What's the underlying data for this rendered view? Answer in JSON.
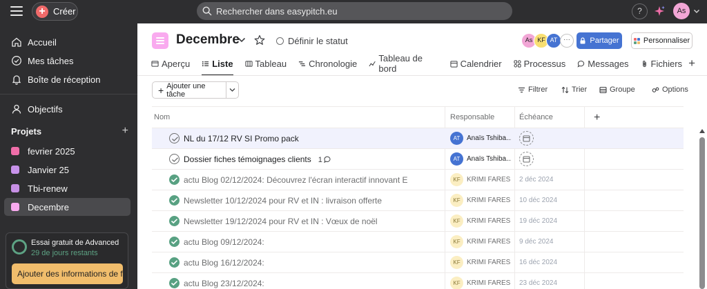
{
  "topbar": {
    "create_label": "Créer",
    "search_placeholder": "Rechercher dans easypitch.eu",
    "help_label": "?",
    "user_initials": "As"
  },
  "sidebar": {
    "nav": [
      {
        "label": "Accueil",
        "icon": "home-icon"
      },
      {
        "label": "Mes tâches",
        "icon": "check-circle-icon"
      },
      {
        "label": "Boîte de réception",
        "icon": "bell-icon"
      },
      {
        "label": "Objectifs",
        "icon": "person-icon"
      }
    ],
    "projects_title": "Projets",
    "projects_add": "+",
    "projects": [
      {
        "label": "fevrier 2025",
        "color": "#f06ea9"
      },
      {
        "label": "Janvier 25",
        "color": "#c792ea"
      },
      {
        "label": "Tbi-renew",
        "color": "#c68fe4"
      },
      {
        "label": "Decembre",
        "color": "#f9aaef",
        "active": true
      }
    ],
    "trial": {
      "title": "Essai gratuit de Advanced",
      "subtitle": "29 de jours restants",
      "button": "Ajouter des informations de facturation"
    }
  },
  "header": {
    "title": "Decembre",
    "status_label": "Définir le statut",
    "members": [
      {
        "initials": "As",
        "color": "#f2a6d6"
      },
      {
        "initials": "KF",
        "color": "#f8df72"
      },
      {
        "initials": "AT",
        "color": "#4573d2"
      }
    ],
    "members_more": "···",
    "share_label": "Partager",
    "customize_label": "Personnaliser"
  },
  "tabs": [
    {
      "label": "Aperçu",
      "icon": "overview-icon"
    },
    {
      "label": "Liste",
      "icon": "list-icon",
      "active": true
    },
    {
      "label": "Tableau",
      "icon": "board-icon"
    },
    {
      "label": "Chronologie",
      "icon": "timeline-icon"
    },
    {
      "label": "Tableau de bord",
      "icon": "dashboard-icon"
    },
    {
      "label": "Calendrier",
      "icon": "calendar-icon"
    },
    {
      "label": "Processus",
      "icon": "workflow-icon"
    },
    {
      "label": "Messages",
      "icon": "message-icon"
    },
    {
      "label": "Fichiers",
      "icon": "paperclip-icon"
    }
  ],
  "tabs_add": "+",
  "toolbar": {
    "add_task": "Ajouter une tâche",
    "filter": "Filtrer",
    "sort": "Trier",
    "group": "Groupe",
    "options": "Options"
  },
  "table": {
    "columns": [
      "Nom",
      "Responsable",
      "Échéance"
    ],
    "add_column": "+",
    "rows": [
      {
        "name": "NL du 17/12 RV SI Promo pack",
        "done": false,
        "assignee": "Anaïs Tshiba...",
        "initials": "AT",
        "av_color": "#4573d2",
        "due": "",
        "selected": true
      },
      {
        "name": "Dossier fiches témoignages clients",
        "done": false,
        "comments": "1",
        "assignee": "Anaïs Tshiba...",
        "initials": "AT",
        "av_color": "#4573d2",
        "due": ""
      },
      {
        "name": "actu Blog 02/12/2024: Découvrez l'écran interactif innovant E",
        "done": true,
        "assignee": "KRIMI FARES",
        "initials": "KF",
        "av_color": "#fbeec2",
        "due": "2 déc 2024"
      },
      {
        "name": "Newsletter 10/12/2024  pour RV et IN  : livraison offerte",
        "done": true,
        "assignee": "KRIMI FARES",
        "initials": "KF",
        "av_color": "#fbeec2",
        "due": "10 déc 2024"
      },
      {
        "name": "Newsletter 19/12/2024  pour RV et IN  :  Vœux  de noël",
        "done": true,
        "assignee": "KRIMI FARES",
        "initials": "KF",
        "av_color": "#fbeec2",
        "due": "19 déc 2024"
      },
      {
        "name": "actu Blog 09/12/2024:",
        "done": true,
        "assignee": "KRIMI FARES",
        "initials": "KF",
        "av_color": "#fbeec2",
        "due": "9 déc 2024"
      },
      {
        "name": "actu Blog 16/12/2024:",
        "done": true,
        "assignee": "KRIMI FARES",
        "initials": "KF",
        "av_color": "#fbeec2",
        "due": "16 déc 2024"
      },
      {
        "name": "actu Blog 23/12/2024:",
        "done": true,
        "assignee": "KRIMI FARES",
        "initials": "KF",
        "av_color": "#fbeec2",
        "due": "23 déc 2024"
      }
    ]
  }
}
